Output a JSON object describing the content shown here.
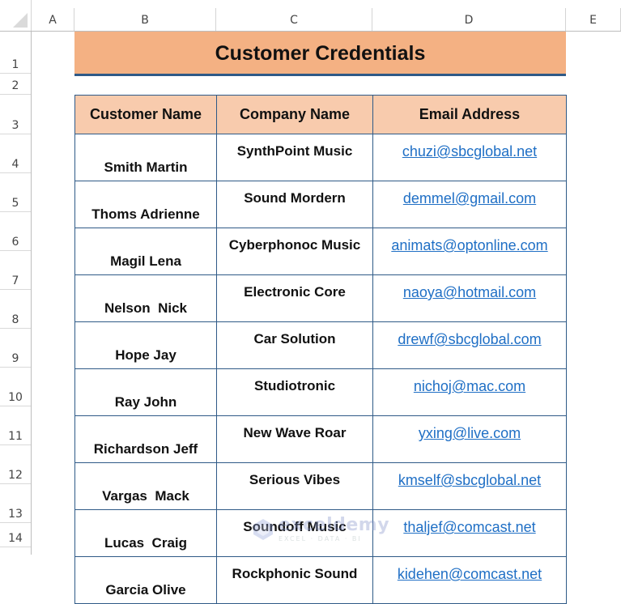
{
  "spreadsheet": {
    "columns": [
      "A",
      "B",
      "C",
      "D",
      "E"
    ],
    "rows": [
      "1",
      "2",
      "3",
      "4",
      "5",
      "6",
      "7",
      "8",
      "9",
      "10",
      "11",
      "12",
      "13",
      "14"
    ]
  },
  "title": "Customer Credentials",
  "table": {
    "headers": [
      "Customer Name",
      "Company Name",
      "Email Address"
    ],
    "rows": [
      {
        "name": "Smith Martin",
        "company": "SynthPoint Music",
        "email": "chuzi@sbcglobal.net"
      },
      {
        "name": "Thoms Adrienne",
        "company": "Sound Mordern",
        "email": "demmel@gmail.com"
      },
      {
        "name": "Magil Lena",
        "company": "Cyberphonoc Music",
        "email": "animats@optonline.com"
      },
      {
        "name": "Nelson  Nick",
        "company": "Electronic Core",
        "email": "naoya@hotmail.com"
      },
      {
        "name": "Hope Jay",
        "company": "Car Solution",
        "email": "drewf@sbcglobal.com"
      },
      {
        "name": "Ray John",
        "company": "Studiotronic",
        "email": "nichoj@mac.com"
      },
      {
        "name": "Richardson Jeff",
        "company": "New Wave Roar",
        "email": "yxing@live.com"
      },
      {
        "name": "Vargas  Mack",
        "company": "Serious Vibes",
        "email": "kmself@sbcglobal.net"
      },
      {
        "name": "Lucas  Craig",
        "company": "Soundoff Music",
        "email": "thaljef@comcast.net"
      },
      {
        "name": "Garcia Olive",
        "company": "Rockphonic Sound",
        "email": "kidehen@comcast.net"
      }
    ]
  },
  "colors": {
    "title_fill": "#f4b183",
    "header_fill": "#f8cbad",
    "border": "#2f5a87",
    "link": "#1f6fc5"
  },
  "watermark": {
    "name": "exceldemy",
    "tagline": "EXCEL · DATA · BI"
  }
}
